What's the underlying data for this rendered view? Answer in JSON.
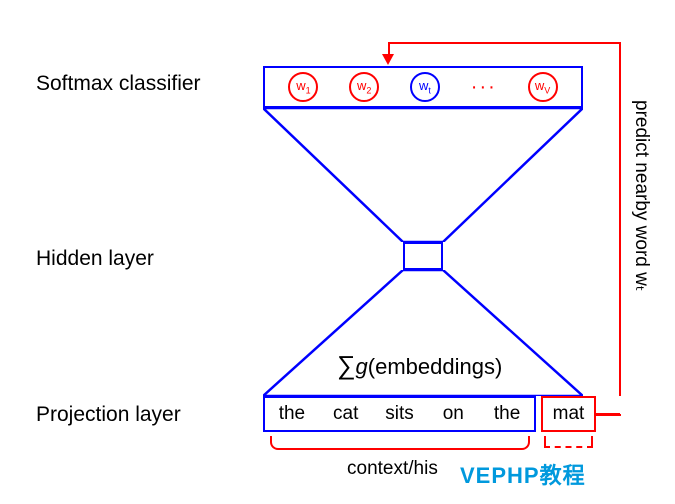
{
  "labels": {
    "softmax": "Softmax classifier",
    "hidden": "Hidden layer",
    "projection": "Projection layer",
    "context": "context/his",
    "side": "predict nearby word wₜ",
    "formula": "∑g(embeddings)"
  },
  "softmax_tokens": {
    "w1": "w",
    "w1_sub": "1",
    "w2": "w",
    "w2_sub": "2",
    "wt": "w",
    "wt_sub": "t",
    "ellipsis": "···",
    "wv": "w",
    "wv_sub": "V"
  },
  "projection_words": [
    "the",
    "cat",
    "sits",
    "on",
    "the"
  ],
  "target_word": "mat",
  "watermark": "VEPHP教程"
}
